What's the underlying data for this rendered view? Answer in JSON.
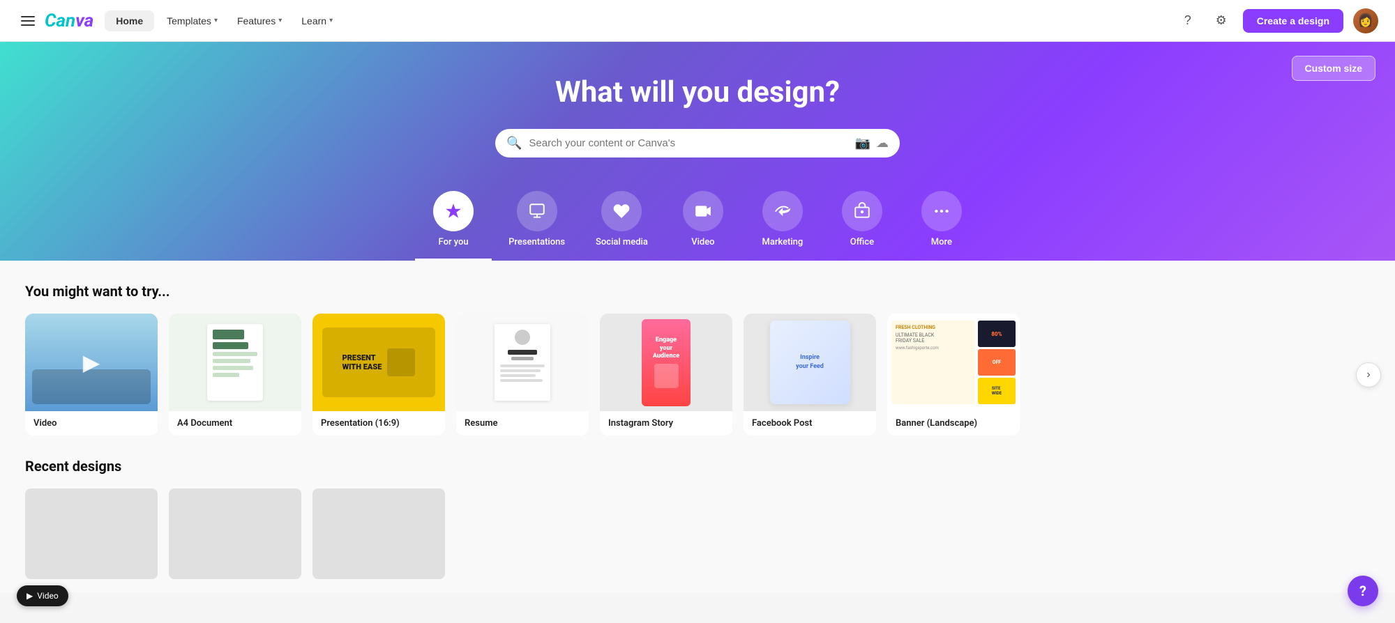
{
  "brand": {
    "logo": "Canva"
  },
  "navbar": {
    "hamburger_label": "menu",
    "home_label": "Home",
    "templates_label": "Templates",
    "features_label": "Features",
    "learn_label": "Learn",
    "help_tooltip": "Help",
    "settings_tooltip": "Settings",
    "create_btn_label": "Create a design"
  },
  "hero": {
    "title": "What will you design?",
    "search_placeholder": "Search your content or Canva's",
    "custom_size_label": "Custom size"
  },
  "categories": [
    {
      "id": "for-you",
      "label": "For you",
      "icon": "✦",
      "active": true
    },
    {
      "id": "presentations",
      "label": "Presentations",
      "icon": "📊",
      "active": false
    },
    {
      "id": "social-media",
      "label": "Social media",
      "icon": "❤",
      "active": false
    },
    {
      "id": "video",
      "label": "Video",
      "icon": "▶",
      "active": false
    },
    {
      "id": "marketing",
      "label": "Marketing",
      "icon": "📢",
      "active": false
    },
    {
      "id": "office",
      "label": "Office",
      "icon": "💼",
      "active": false
    },
    {
      "id": "more",
      "label": "More",
      "icon": "•••",
      "active": false
    }
  ],
  "try_section": {
    "title": "You might want to try...",
    "scroll_next_label": "›",
    "cards": [
      {
        "id": "video",
        "label": "Video",
        "thumb_type": "video"
      },
      {
        "id": "a4-doc",
        "label": "A4 Document",
        "thumb_type": "a4"
      },
      {
        "id": "presentation",
        "label": "Presentation (16:9)",
        "thumb_type": "presentation"
      },
      {
        "id": "resume",
        "label": "Resume",
        "thumb_type": "resume"
      },
      {
        "id": "instagram-story",
        "label": "Instagram Story",
        "thumb_type": "story"
      },
      {
        "id": "facebook-post",
        "label": "Facebook Post",
        "thumb_type": "facebook"
      },
      {
        "id": "banner-landscape",
        "label": "Banner (Landscape)",
        "thumb_type": "banner"
      }
    ]
  },
  "recent_section": {
    "title": "Recent designs"
  },
  "help_bubble_label": "?",
  "video_bubble_label": "Video"
}
